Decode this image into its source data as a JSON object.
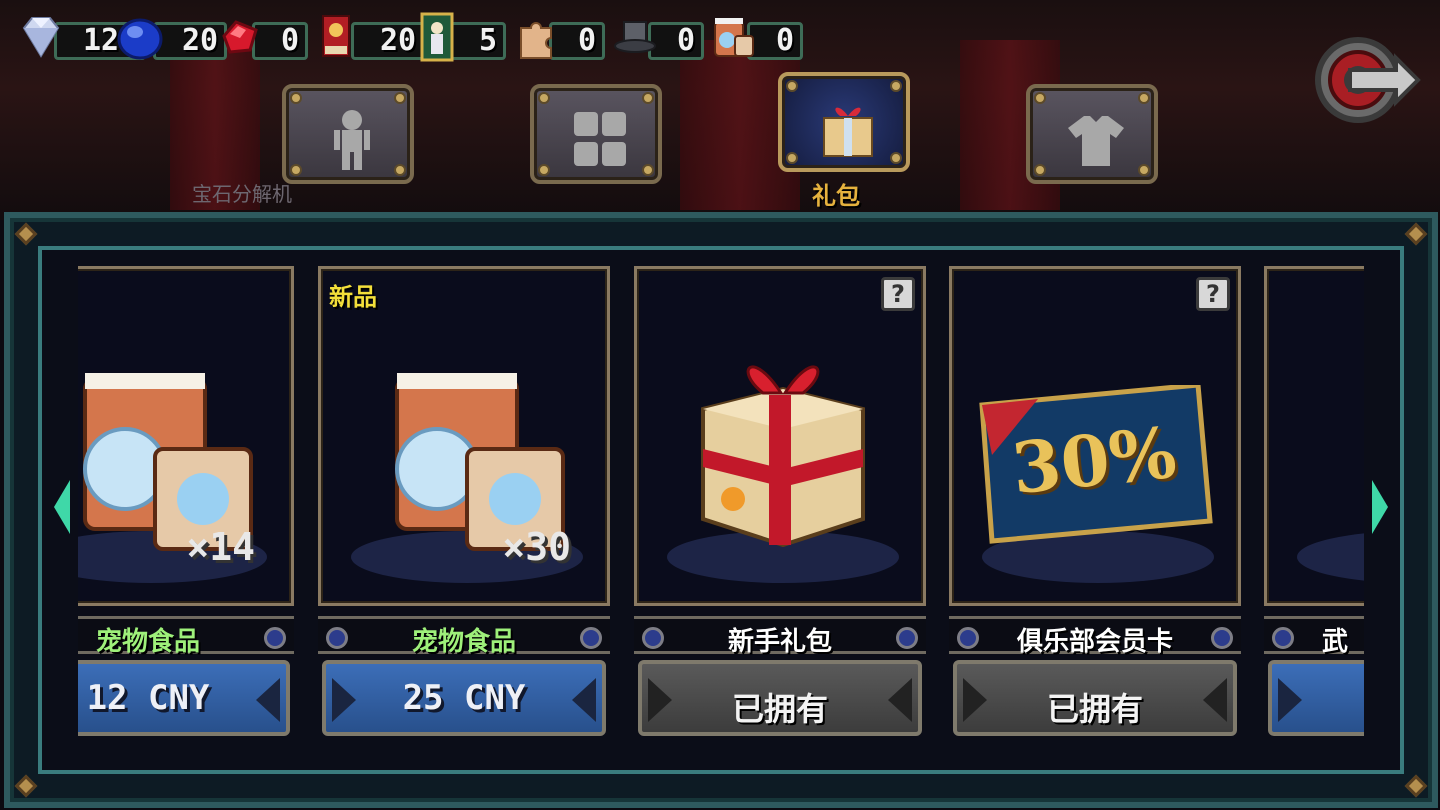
{
  "resources": [
    {
      "name": "diamond",
      "icon": "diamond-icon",
      "value": "128"
    },
    {
      "name": "sapphire",
      "icon": "blue-gem-icon",
      "value": "20"
    },
    {
      "name": "ruby",
      "icon": "red-gem-icon",
      "value": "0"
    },
    {
      "name": "ticket",
      "icon": "ticket-icon",
      "value": "20"
    },
    {
      "name": "card",
      "icon": "tarot-card-icon",
      "value": "5"
    },
    {
      "name": "puzzle",
      "icon": "puzzle-piece-icon",
      "value": "0"
    },
    {
      "name": "hat",
      "icon": "top-hat-icon",
      "value": "0"
    },
    {
      "name": "pet-food",
      "icon": "pet-food-icon",
      "value": "0"
    }
  ],
  "background": {
    "label": "宝石分解机"
  },
  "tabs": [
    {
      "name": "character",
      "icon": "character-icon",
      "active": false
    },
    {
      "name": "skins",
      "icon": "dice-icon",
      "active": false
    },
    {
      "name": "gift",
      "icon": "gift-icon",
      "active": true,
      "label": "礼包"
    },
    {
      "name": "outfit",
      "icon": "shirt-icon",
      "active": false
    }
  ],
  "cards": [
    {
      "name": "宠物食品",
      "price": "12 CNY",
      "quantity": "×14",
      "state": "buy",
      "highlight_name": true
    },
    {
      "name": "宠物食品",
      "price": "25 CNY",
      "quantity": "×30",
      "state": "buy",
      "highlight_name": true,
      "badge": "新品"
    },
    {
      "name": "新手礼包",
      "status": "已拥有",
      "state": "owned",
      "help": "?"
    },
    {
      "name": "俱乐部会员卡",
      "status": "已拥有",
      "state": "owned",
      "help": "?",
      "art_text": "30%"
    },
    {
      "name": "武",
      "state": "buy"
    }
  ],
  "colors": {
    "panel_border": "#2e5a5e",
    "price_button": "#3c6eb8",
    "owned_button": "#5a5a5a",
    "active_tab": "#2a3a78",
    "tab_label": "#e6b23e",
    "name_highlight": "#9ef07a"
  }
}
